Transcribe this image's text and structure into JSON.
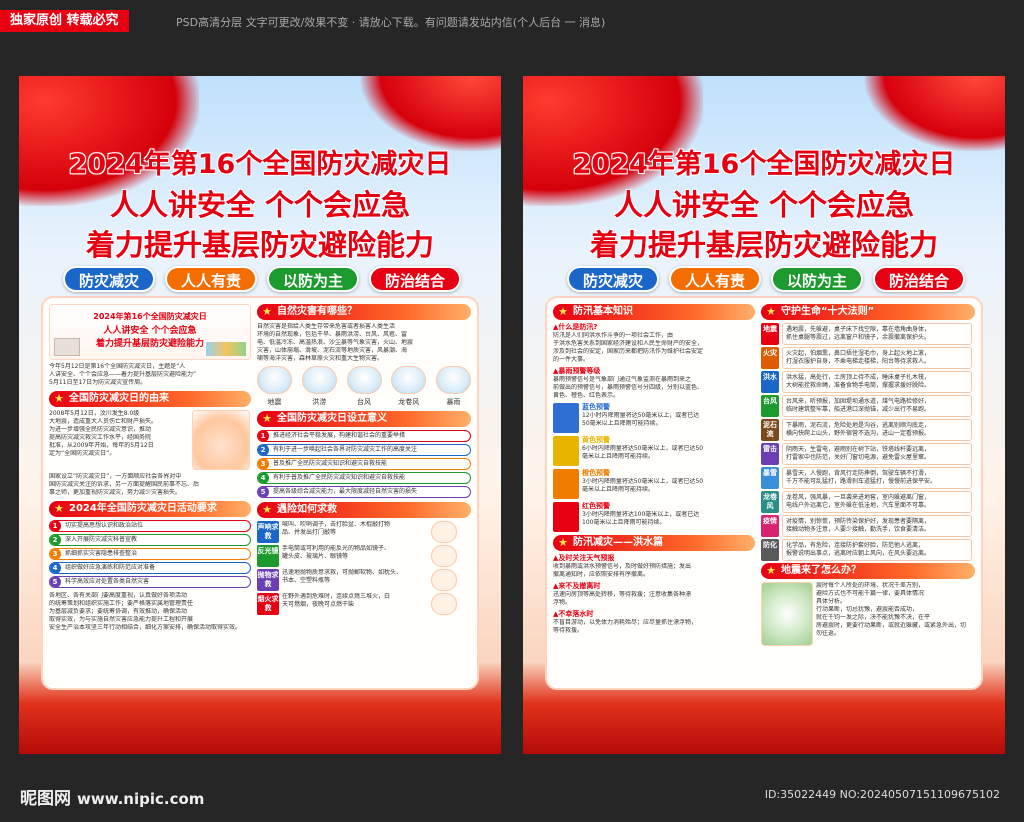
{
  "topbar": {
    "badge": "独家原创 转载必究",
    "note": "PSD高清分层 文字可更改/效果不变 · 请放心下载。有问题请发站内信(个人后台 一 消息)"
  },
  "poster": {
    "title1": "2024年第16个全国防灾减灾日",
    "title2": "人人讲安全 个个会应急",
    "title3": "着力提升基层防灾避险能力",
    "pills": [
      {
        "label": "防灾减灾",
        "color": "#1a66c9"
      },
      {
        "label": "人人有责",
        "color": "#f36d00"
      },
      {
        "label": "以防为主",
        "color": "#1d9a2e"
      },
      {
        "label": "防治结合",
        "color": "#e60012"
      }
    ]
  },
  "left": {
    "mini_banner": [
      "2024年第16个全国防灾减灾日",
      "人人讲安全 个个会应急",
      "着力提升基层防灾避险能力"
    ],
    "intro": [
      "今年5月12日是第16个全国防灾减灾日，主题是“人",
      "人讲安全、个个会应急——着力提升基层防灾避险能力”",
      "5月11日至17日为防灾减灾宣传周。"
    ],
    "origin_title": "全国防灾减灾日的由来",
    "origin_text": [
      "2008年5月12日，汶川发生8.0级",
      "大地震，造成重大人员伤亡和财产损失。",
      "为进一步增强全民防灾减灾意识，推动",
      "提高防灾减灾救灾工作水平，经国务院",
      "批准，从2009年开始，每年的5月12日",
      "定为“全国防灾减灾日”。"
    ],
    "origin_text2": [
      "国家设立“防灾减灾日”，一方面顺应社会各界对中",
      "国防灾减灾关注的诉求，另一方面提醒国民前事不忘、后",
      "事之师，更加重视防灾减灾，努力减少灾害损失。"
    ],
    "activities_title": "2024年全国防灾减灾日活动要求",
    "activities": [
      "切实提高思想认识和政治站位",
      "深入开展防灾减灾科普宣教",
      "抓细抓实灾害隐患排查整治",
      "组织做好应急演练和防范应对准备",
      "科学高效应对处置各类自然灾害"
    ],
    "activities_text": [
      "各地区、各有关部门要高度重视，认真做好各项活动",
      "的统筹策划和组织实施工作；要严格落实属地管理责任",
      "为基层减负要求；要统筹协调，有效推动，确保活动",
      "取得实效，为与实施自然灾害应急能力提升工程和开展",
      "安全生产治本攻坚三年行动相结合，细化方案安排，确保活动取得实效。"
    ],
    "hazard_title": "自然灾害有哪些？",
    "hazard_text": [
      "自然灾害是指给人类生存带来危害或者损害人类生活",
      "环境的自然现象，包括干旱、暴雨洪涝、台风、风雹、雷",
      "电、低温冷冻、高温热浪、沙尘暴等气象灾害，火山、地震",
      "灾害，山体崩塌、滑坡、泥石流等地质灾害，风暴潮、海",
      "啸等海洋灾害，森林草原火灾和重大生物灾害。"
    ],
    "hazard_icons": [
      "地震",
      "洪涝",
      "台风",
      "龙卷风",
      "暴雨"
    ],
    "meaning_title": "全国防灾减灾日设立意义",
    "meaning": [
      "推进经济社会平稳发展，构建和谐社会的重要举措",
      "有利于进一步唤起社会各界对防灾减灾工作的高度关注",
      "普及推广全民防灾减灾知识和避灾自救技能",
      "有利于普及推广全民防灾减灾知识和避灾自救技能",
      "提高各级综合减灾能力，最大限度减轻自然灾害的损失"
    ],
    "rescue_title": "遇险如何求救",
    "rescue": [
      {
        "tag": "声响求救",
        "text": [
          "喊叫、吹哨调子，击打脸盆、木棍敲打物",
          "品、并发出打门敲等"
        ]
      },
      {
        "tag": "反光镜",
        "text": [
          "手电筒或可利用的能反光的物品如镜子、",
          "罐头皮、玻璃片、眼镜等"
        ]
      },
      {
        "tag": "抛物求救",
        "text": [
          "迅速地抛物质意求救，可抛郵软物、如枕头、",
          "书本、空塑料瓶等"
        ]
      },
      {
        "tag": "烟火求救",
        "text": [
          "在野外遇到危难时，连续点燃三堆火，白",
          "天可燃烟，夜晚可点燃干柴"
        ]
      }
    ]
  },
  "right": {
    "flood_title": "防汛基本知识",
    "flood_q": "▲什么是防汛?",
    "flood_text": [
      "防汛是人们同洪水作斗争的一项社会工作，由",
      "于洪水危害关系到国家经济建设和人民生命财产的安全，",
      "涉及到社会的安定，国家历来都把防汛作为维护社会安定",
      "的一件大事。"
    ],
    "rainstorm_q": "▲暴雨预警等级",
    "rainstorm_text": [
      "暴雨预警信号是气象部门通过气象监测在暴雨到来之",
      "前做出的预警信号，暴雨预警信号分四级，分别以蓝色、",
      "黄色、橙色、红色表示。"
    ],
    "warnings": [
      {
        "title": "蓝色预警",
        "color": "#2d6fd2",
        "lines": [
          "12小时内降雨量将达50毫米以上，或者已达",
          "50毫米以上且降雨可能持续。"
        ]
      },
      {
        "title": "黄色预警",
        "color": "#e7b400",
        "lines": [
          "6小时内降雨量将达50毫米以上，或者已达50",
          "毫米以上且降雨可能持续。"
        ]
      },
      {
        "title": "橙色预警",
        "color": "#f07d00",
        "lines": [
          "3小时内降雨量将达50毫米以上，或者已达50",
          "毫米以上且降雨可能持续。"
        ]
      },
      {
        "title": "红色预警",
        "color": "#e60012",
        "lines": [
          "3小时内降雨量将达100毫米以上，或者已达",
          "100毫米以上且降雨可能持续。"
        ]
      }
    ],
    "flood2_title": "防汛减灾——洪水篇",
    "flood2_items": [
      {
        "head": "▲及时关注天气预报",
        "lines": [
          "收到暴雨或洪水预警信号，及时做好预防措施；发出",
          "撤离通知时，应依照安排有序撤离。"
        ]
      },
      {
        "head": "▲来不及撤离时",
        "lines": [
          "迅速向房顶等高处转移，等待救援；注意收集各种漂",
          "浮物。"
        ]
      },
      {
        "head": "▲不幸落水时",
        "lines": [
          "不盲目游动，以免体力消耗殆尽；应尽量抓住漂浮物，",
          "等待救援。"
        ]
      }
    ],
    "laws_title": "守护生命“十大法则”",
    "laws": [
      {
        "tag": "地震",
        "color": "#e60012",
        "lines": [
          "遇地震，先躲避，桌子床下找空隙，靠在墙角曲身体，",
          "抓住桌腿等震过，远离窗户和镜子，余震撤离保护头。"
        ]
      },
      {
        "tag": "火灾",
        "color": "#e05a00",
        "lines": [
          "火灾起，怕烟熏，鼻口捂住湿毛巾，身上起火地上滚，",
          "打湿衣服护自身，不乘电梯走楼梯，阳台等待求救人。"
        ]
      },
      {
        "tag": "洪水",
        "color": "#1a66c9",
        "lines": [
          "洪水猛，高处行，土房顶上待不成，睡床桌子扎木筏，",
          "大树能拴救命绳，准备食物手电筒，撑握求援好脱险。"
        ]
      },
      {
        "tag": "台风",
        "color": "#1d9a2e",
        "lines": [
          "台风来，听预报，加固堤坝通水道，煤气电路检修好，",
          "临时建筑整牢靠，船进港口深抛锚，减少出行不易跑。"
        ]
      },
      {
        "tag": "泥石流",
        "color": "#7a4a1a",
        "lines": [
          "下暴雨，泥石流，危险处地是沟谷，逃离别顺沟底走，",
          "横向快爬上山头，野外宿营不选沟，进山一定看预报。"
        ]
      },
      {
        "tag": "雷击",
        "color": "#6b3fb3",
        "lines": [
          "阴雨天，生雷电，避雨别在树下站，铁塔线杆要远离，",
          "打雷家中也防范，关好门窗切电源，避免雷火屋里窜。"
        ]
      },
      {
        "tag": "暴雪",
        "color": "#3b8fd9",
        "lines": [
          "暴雪天，人慢跑，背风行走防摔倒，驾驶车辆不打滑，",
          "千万不能可乱猛打，路滑刹车道猛打，慢慢前进保平安。"
        ]
      },
      {
        "tag": "龙卷风",
        "color": "#2a8f86",
        "lines": [
          "龙卷风，强风暴，一旦袭来进地窖，室内躲避离门窗，",
          "电线户外远离它，室外躲在低洼地，汽车里面不可靠。"
        ]
      },
      {
        "tag": "疫情",
        "color": "#d6246e",
        "lines": [
          "对疫情，别惊慌，预防传染保护好，发现患者要隔离，",
          "接触动物多注意，人要少接触，勤洗手，饮食要清洁。"
        ]
      },
      {
        "tag": "防化",
        "color": "#5a5a5a",
        "lines": [
          "化学品，有危险，连接防护套好脸，防范他人逃离，",
          "报警说明出事点，逃离时应朝上风向，在风头要远离。"
        ]
      }
    ],
    "quake_title": "地震来了怎么办？",
    "quake_text": [
      "震时每个人所处的环境、状况千差万别，",
      "避险方式也不可能千篇一律，要具体情况",
      "具体分析。",
      "行动果断，切忌犹豫，避震能否成功，",
      "就在千钧一发之际，决不能犹豫不决，在平",
      "房避震时，更要行动果断，或就近躲藏，或紧急外出，切",
      "勿往返。"
    ]
  },
  "footer": {
    "logo": "昵图网",
    "url": "www.nipic.com",
    "id": "ID:35022449 NO:20240507151109675102"
  }
}
